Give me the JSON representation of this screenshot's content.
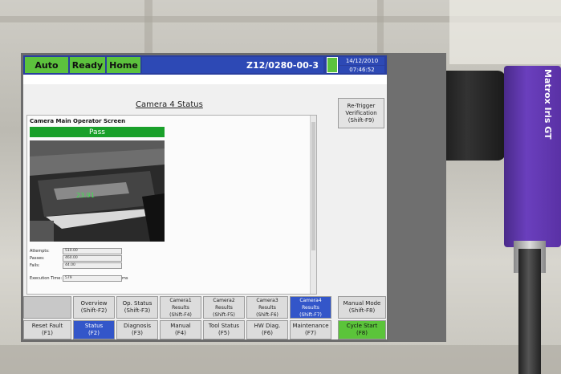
{
  "topbar": {
    "mode": "Auto",
    "state": "Ready",
    "home": "Home",
    "part_number": "Z12/0280-00-3",
    "date": "14/12/2010",
    "time": "07:46:52"
  },
  "screen_title": "Camera 4 Status",
  "retrigger": {
    "line1": "Re-Trigger",
    "line2": "Verification",
    "line3": "(Shift-F9)"
  },
  "panel": {
    "title": "Camera Main Operator Screen",
    "result": "Pass",
    "measured_value": "23.91",
    "stats": [
      {
        "label": "Attempts:",
        "value": "510.00"
      },
      {
        "label": "Passes:",
        "value": "460.00"
      },
      {
        "label": "Fails:",
        "value": "44.00"
      }
    ],
    "exec_label": "Execution Time:",
    "exec_value": "579",
    "exec_unit": "ms"
  },
  "buttons_row1": [
    {
      "label": "",
      "sub": ""
    },
    {
      "label": "Overview",
      "sub": "(Shift-F2)"
    },
    {
      "label": "Op. Status",
      "sub": "(Shift-F3)"
    },
    {
      "label": "Camera1 Results",
      "sub": "(Shift-F4)"
    },
    {
      "label": "Camera2 Results",
      "sub": "(Shift-F5)"
    },
    {
      "label": "Camera3 Results",
      "sub": "(Shift-F6)"
    },
    {
      "label": "Camera4 Results",
      "sub": "(Shift-F7)"
    },
    {
      "label": "Manual Mode",
      "sub": "(Shift-F8)"
    }
  ],
  "buttons_row2": [
    {
      "label": "Reset Fault",
      "sub": "(F1)"
    },
    {
      "label": "Status",
      "sub": "(F2)"
    },
    {
      "label": "Diagnosis",
      "sub": "(F3)"
    },
    {
      "label": "Manual",
      "sub": "(F4)"
    },
    {
      "label": "Tool Status",
      "sub": "(F5)"
    },
    {
      "label": "HW Diag.",
      "sub": "(F6)"
    },
    {
      "label": "Maintenance",
      "sub": "(F7)"
    },
    {
      "label": "Cycle Start",
      "sub": "(F8)"
    }
  ],
  "camera_brand": "Matrox Iris GT",
  "colors": {
    "status_green": "#5cc23d",
    "topbar_blue": "#2a3fa0",
    "pass_green": "#19a02a",
    "camera_purple": "#6a3fbd"
  }
}
